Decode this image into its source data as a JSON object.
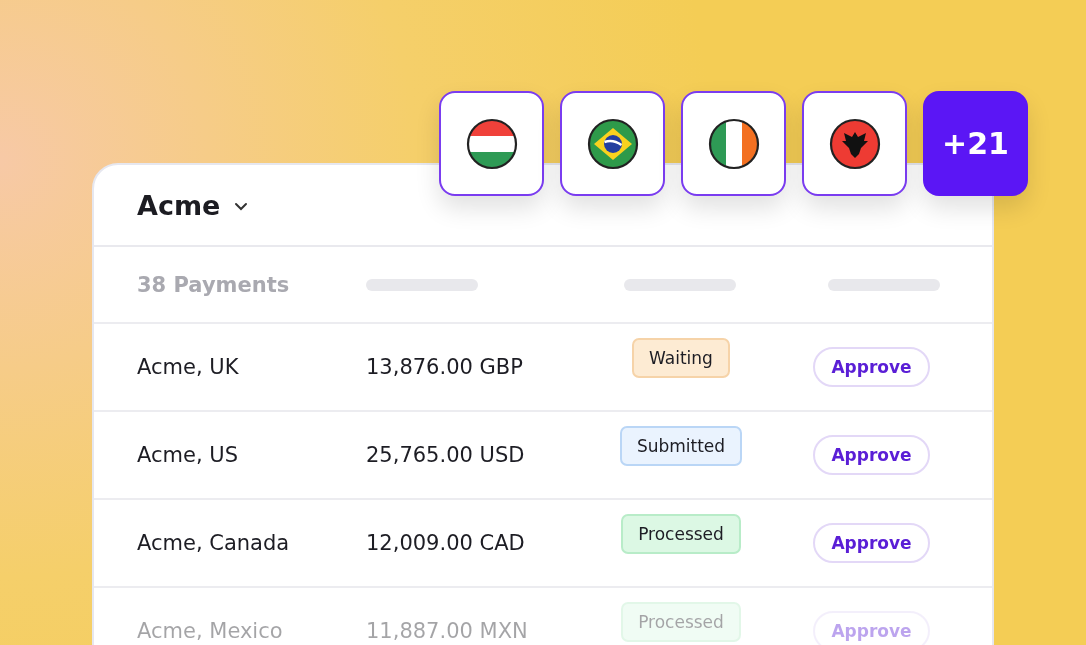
{
  "flags": [
    {
      "kind": "hungary"
    },
    {
      "kind": "brazil"
    },
    {
      "kind": "ireland"
    },
    {
      "kind": "albania"
    }
  ],
  "more_count": "+21",
  "account": {
    "name": "Acme"
  },
  "table": {
    "count_label": "38 Payments",
    "rows": [
      {
        "name": "Acme, UK",
        "amount": "13,876.00 GBP",
        "status": {
          "kind": "waiting",
          "label": "Waiting"
        },
        "action": "Approve",
        "faded": false
      },
      {
        "name": "Acme, US",
        "amount": "25,765.00 USD",
        "status": {
          "kind": "submitted",
          "label": "Submitted"
        },
        "action": "Approve",
        "faded": false
      },
      {
        "name": "Acme, Canada",
        "amount": "12,009.00 CAD",
        "status": {
          "kind": "processed",
          "label": "Processed"
        },
        "action": "Approve",
        "faded": false
      },
      {
        "name": "Acme, Mexico",
        "amount": "11,887.00 MXN",
        "status": {
          "kind": "processed",
          "label": "Processed"
        },
        "action": "Approve",
        "faded": true
      }
    ]
  }
}
